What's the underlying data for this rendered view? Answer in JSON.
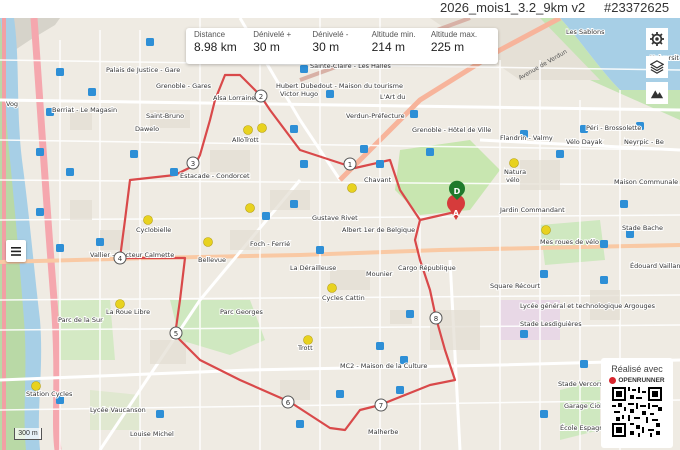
{
  "route": {
    "title": "2026_mois1_3.2_9km v2",
    "id": "#23372625"
  },
  "stats": [
    {
      "label": "Distance",
      "value": "8.98 km"
    },
    {
      "label": "Dénivelé +",
      "value": "30 m"
    },
    {
      "label": "Dénivelé -",
      "value": "30 m"
    },
    {
      "label": "Altitude min.",
      "value": "214 m"
    },
    {
      "label": "Altitude max.",
      "value": "225 m"
    }
  ],
  "toolbar": {
    "settings_icon": "gear-icon",
    "layers_icon": "layers-icon",
    "elevation_icon": "mountain-icon",
    "menu_icon": "hamburger-icon"
  },
  "markers": {
    "start": "D",
    "finish": "A",
    "km": [
      "1",
      "2",
      "3",
      "4",
      "5",
      "6",
      "7",
      "8"
    ]
  },
  "branding": {
    "made_with": "Réalisé avec",
    "brand": "OPENRUNNER"
  },
  "scale": {
    "label": "300 m"
  },
  "map_labels": {
    "palais": "Palais de Justice - Gare",
    "berriat": "Berriat - Le Magasin",
    "grenoble_gares": "Grenoble - Gares",
    "saint_bruno": "Saint-Bruno",
    "dawelo": "Dawelo",
    "alsace": "Alsa Lorraine",
    "hubert": "Hubert Dubedout - Maison du tourisme",
    "victor_hugo": "Victor Hugo",
    "sainte_claire": "Sainte-Claire - Les Halles",
    "verdun": "Verdun-Préfecture",
    "lart": "L'Art du",
    "hotel_ville": "Grenoble - Hôtel de Ville",
    "flandrin": "Flandrin - Valmy",
    "peri": "Péri - Brossolette",
    "velo_dayak": "Vélo Dayak",
    "neyrpic": "Neyrpic - Be",
    "maison_communale": "Maison Communale",
    "natura": "Natura",
    "velo_short": "vélo",
    "allotrott": "AlloTrott",
    "estacade": "Estacade - Condorcet",
    "chavant": "Chavant",
    "gustave": "Gustave Rivet",
    "albert": "Albert 1er de Belgique",
    "foch": "Foch - Ferrié",
    "cyclobielle": "Cyclobielle",
    "vallier": "Vallier - Docteur Calmette",
    "bellevue": "Bellevue",
    "deraille": "La Dérailleuse",
    "mounier": "Mounier",
    "cargo": "Cargo République",
    "mes_roues": "Mes roues de vélo",
    "edouard": "Édouard Vaillant",
    "stade": "Stade Bache",
    "jardin": "Jardin Commandant",
    "square": "Square Récourt",
    "lycee": "Lycée général et technologique Argouges",
    "la_roue_libre": "La Roue Libre",
    "cycles_cattin": "Cycles Cattin",
    "parc_georges": "Parc Georges",
    "trott": "Trott",
    "mc2": "MC2 - Maison de la Culture",
    "station_cycles": "Station Cycles",
    "lycee_vaucanson": "Lycée Vaucanson",
    "louise": "Louise Michel",
    "malherbe": "Malherbe",
    "stade_vercors": "Stade Vercors",
    "ecole": "École Espagnol",
    "les_sablons": "Les Sablons",
    "universite": "Universit",
    "avenue": "Avenue de Verdun",
    "parc_sur": "Parc de la Sur",
    "vog": "Vog",
    "stade_lesdi": "Stade Lesdiguières",
    "garage": "Garage Ciolfi"
  }
}
